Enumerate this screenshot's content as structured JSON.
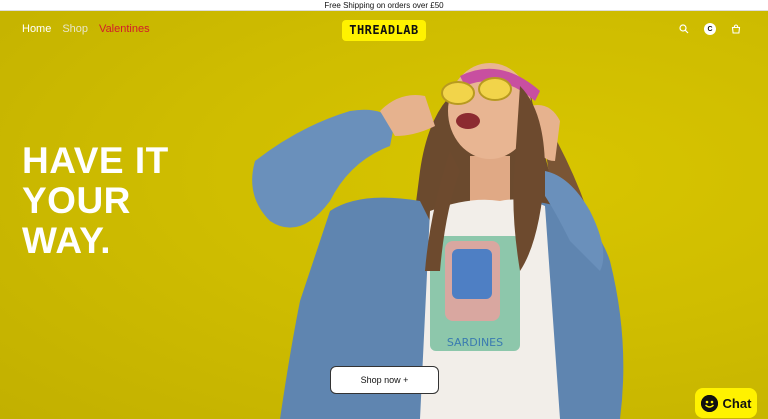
{
  "announcement": {
    "text": "Free Shipping on orders over £50"
  },
  "header": {
    "nav": [
      {
        "label": "Home"
      },
      {
        "label": "Shop"
      },
      {
        "label": "Valentines"
      }
    ],
    "logo_text": "THREADLAB",
    "avatar_initial": "C",
    "icons": [
      "search-icon",
      "account-avatar",
      "cart-icon"
    ]
  },
  "hero": {
    "headline": "HAVE IT\nYOUR\nWAY.",
    "cta_label": "Shop now +",
    "shirt_text": "SARDINES"
  },
  "chat": {
    "label": "Chat"
  },
  "colors": {
    "hero_bg": "#cfbd00",
    "logo_bg": "#fff200",
    "sale_link": "#d31b2a",
    "chat_bg": "#fff200"
  }
}
